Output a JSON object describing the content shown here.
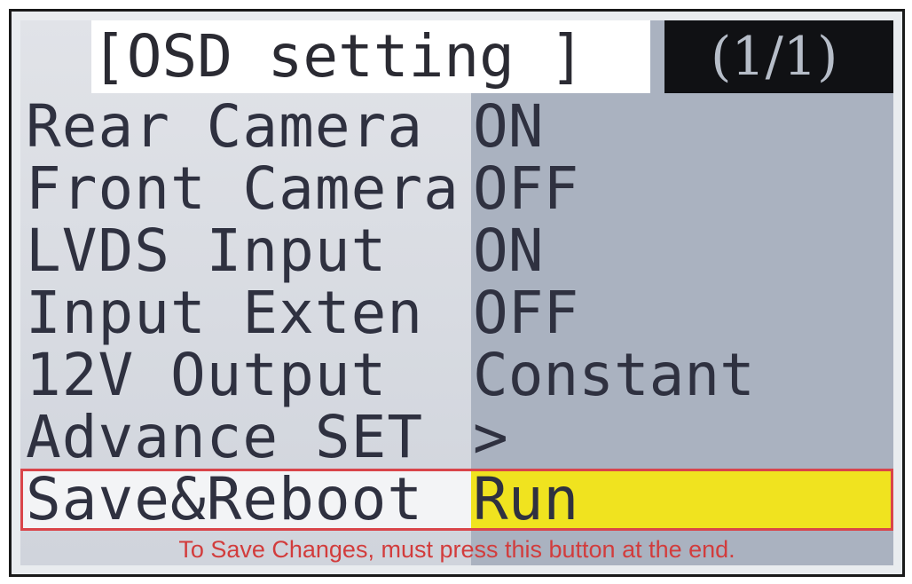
{
  "header": {
    "title": "[OSD setting ]",
    "page_indicator": "(1/1)"
  },
  "menu": {
    "items": [
      {
        "label": "Rear Camera",
        "value": "ON"
      },
      {
        "label": "Front Camera",
        "value": "OFF"
      },
      {
        "label": "LVDS Input",
        "value": "ON"
      },
      {
        "label": "Input Exten",
        "value": "OFF"
      },
      {
        "label": "12V Output",
        "value": "Constant"
      },
      {
        "label": "Advance SET",
        "value": ">"
      },
      {
        "label": "Save&Reboot",
        "value": "Run"
      }
    ],
    "selected_index": 6
  },
  "notice": "To Save Changes, must press this button at the end.",
  "colors": {
    "highlight": "#f0e31f",
    "selection_border": "#d9454a",
    "notice_text": "#d23c3c",
    "value_panel": "#aab2c0"
  }
}
